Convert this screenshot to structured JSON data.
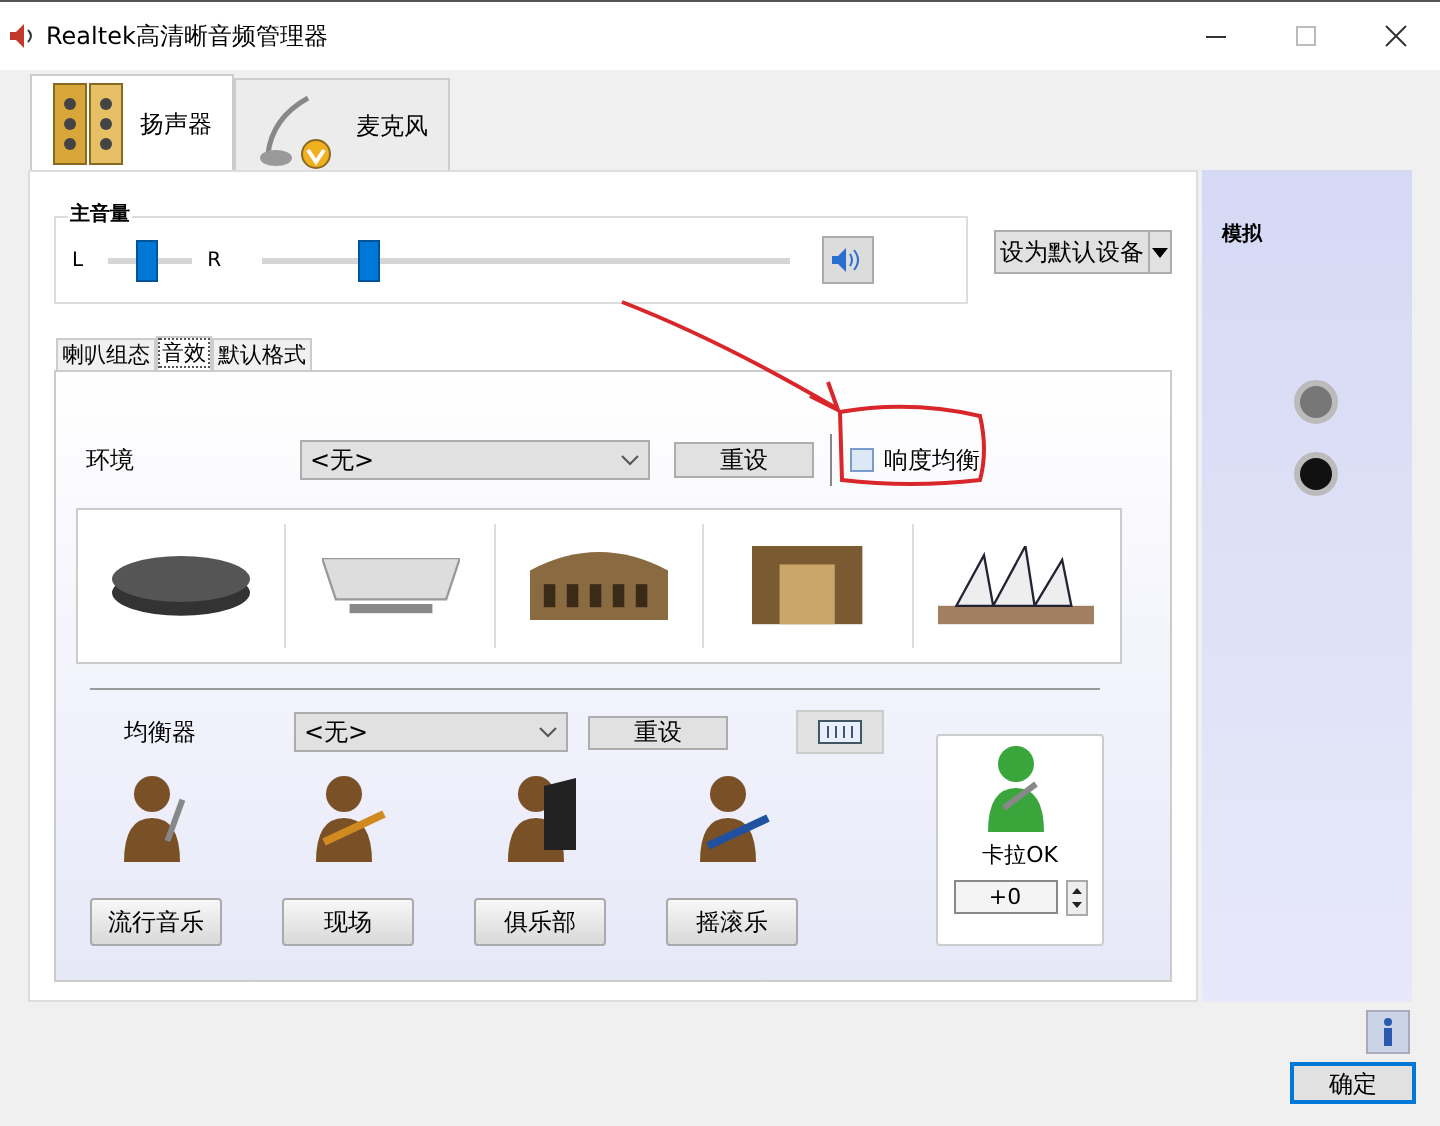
{
  "window": {
    "title": "Realtek高清晰音频管理器"
  },
  "device_tabs": [
    {
      "label": "扬声器",
      "kind": "speaker",
      "selected": true
    },
    {
      "label": "麦克风",
      "kind": "microphone",
      "selected": false
    }
  ],
  "master_volume": {
    "label": "主音量",
    "left": "L",
    "right": "R",
    "balance": {
      "level": 0.45
    },
    "volume": {
      "level": 0.19
    }
  },
  "default_device_button": "设为默认设备",
  "sub_tabs": [
    {
      "label": "喇叭组态",
      "selected": false
    },
    {
      "label": "音效",
      "selected": true
    },
    {
      "label": "默认格式",
      "selected": false
    }
  ],
  "environment": {
    "label": "环境",
    "select": "<无>",
    "reset": "重设",
    "loudness": {
      "label": "响度均衡",
      "checked": false
    },
    "presets": [
      {
        "kind": "disc"
      },
      {
        "kind": "bathtub"
      },
      {
        "kind": "colosseum"
      },
      {
        "kind": "stone-room"
      },
      {
        "kind": "opera-house"
      }
    ]
  },
  "equalizer": {
    "label": "均衡器",
    "select": "<无>",
    "reset": "重设",
    "presets": [
      {
        "label": "流行音乐",
        "kind": "singer"
      },
      {
        "label": "现场",
        "kind": "guitarist"
      },
      {
        "label": "俱乐部",
        "kind": "pianist"
      },
      {
        "label": "摇滚乐",
        "kind": "rocker"
      }
    ]
  },
  "karaoke": {
    "label": "卡拉OK",
    "value": "+0"
  },
  "side_panel": {
    "title": "模拟"
  },
  "ok_button": "确定"
}
